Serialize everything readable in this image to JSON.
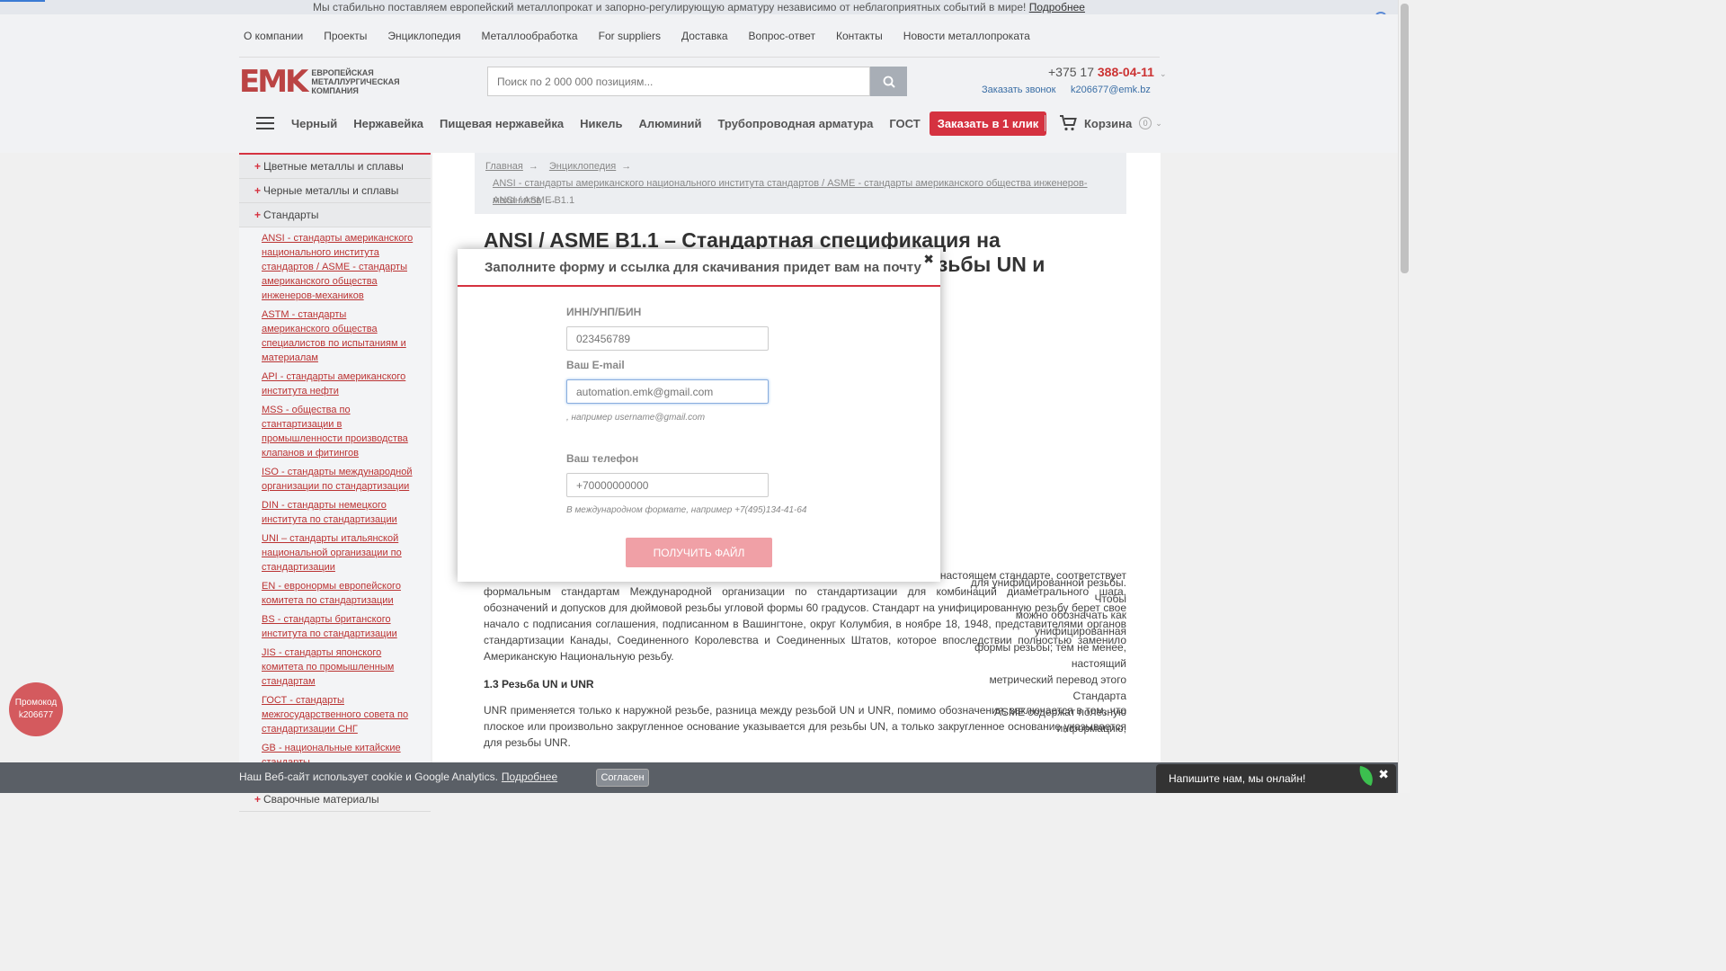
{
  "topbar": {
    "message": "Мы стабильно поставляем европейский металлопрокат и запорно-регулирующую арматуру независимо от неблагоприятных событий в мире!",
    "more_link": "Подробнее"
  },
  "topnav": [
    "О компании",
    "Проекты",
    "Энциклопедия",
    "Металлообработка",
    "For suppliers",
    "Доставка",
    "Вопрос-ответ",
    "Контакты",
    "Новости металлопроката"
  ],
  "logo": {
    "mark": "EMK",
    "line1": "ЕВРОПЕЙСКАЯ",
    "line2": "МЕТАЛЛУРГИЧЕСКАЯ",
    "line3": "КОМПАНИЯ"
  },
  "search": {
    "placeholder": "Поиск по 2 000 000 позициям..."
  },
  "contacts": {
    "phone_prefix": "+375 17 ",
    "phone_main": "388-04-11",
    "callback": "Заказать звонок",
    "email": "k206677@emk.bz"
  },
  "catnav": {
    "items": [
      "Черный",
      "Нержавейка",
      "Пищевая нержавейка",
      "Никель",
      "Алюминий",
      "Трубопроводная арматура",
      "ГОСТ"
    ],
    "oneclick": "Заказать в 1 клик",
    "cart_label": "Корзина",
    "cart_count": "0"
  },
  "sidebar": {
    "cats": [
      "Цветные металлы и сплавы",
      "Черные металлы и сплавы",
      "Стандарты"
    ],
    "subs": [
      "ANSI - стандарты американского национального института стандартов / ASME - стандарты американского общества инженеров-механиков",
      "ASTM - стандарты американского общества специалистов по испытаниям и материалам",
      "API - стандарты американского института нефти",
      "MSS - общества по стантартизации в промышленности производства клапанов и фитингов",
      "ISO - стандарты международной организации по стандартизации",
      "DIN - стандарты немецкого института по стандартизации",
      "UNI – стандарты итальянской национальной организации по стандартизации",
      "EN - евронормы европейского комитета по стандартизации",
      "BS - стандарты британского института по стандартизации",
      "JIS - стандарты японского комитета по промышленным стандартам",
      "ГОСТ - стандарты межгосударственного совета по стандартизации СНГ",
      "GB - национальные китайские стандарты"
    ],
    "last_cat": "Сварочные материалы"
  },
  "breadcrumbs": {
    "home": "Главная",
    "enc": "Энциклопедия",
    "ansi": "ANSI - стандарты американского национального института стандартов / ASME - стандарты американского общества инженеров-механиков",
    "current": "ANSI / ASME B1.1"
  },
  "article": {
    "title_line1": "ANSI / ASME B1.1 – Стандартная спецификация на",
    "title_line2_tail": "резьбы UN и",
    "right_fragments": [
      "для унифицированной резьбы. Чтобы",
      "можно обозначать как унифицированная",
      "формы резьбы; тем не менее, настоящий",
      "метрический перевод этого Стандарта",
      "ASME содержат полезную информацию,"
    ],
    "para2_tail": "настоящем стандарте, соответствует",
    "para2": "формальным стандартам Международной организации по стандартизации для комбинаций диаметрального шага, обозначений и допусков для дюймовой резьбы угловой формы 60 градусов. Стандарт на унифицированную резьбу берет свое начало с подписания соглашения, подписанном в Вашингтоне, округ Колумбия, в ноябре 18, 1948, представителями органов стандартизации Канады, Соединенного Королевства и Соединенных Штатов, которое впоследствии полностью заменило Американскую Национальную резьбу.",
    "h13": "1.3 Резьба UN и UNR",
    "para3": "UNR применяется только к наружной резьбе, разница между резьбой UN и UNR, помимо обозначения, заключается в том, что плоское или произвольно закругленное основание указывается для резьбы UN, а только закругленное основание указывается для резьбы UNR."
  },
  "modal": {
    "heading": "Заполните форму и ссылка для скачивания придет вам на почту",
    "inn_label": "ИНН/УНП/БИН",
    "inn_placeholder": "023456789",
    "email_label": "Ваш E-mail",
    "email_value": "automation.emk@gmail.com",
    "email_hint": ", например username@gmail.com",
    "phone_label": "Ваш телефон",
    "phone_placeholder": "+70000000000",
    "phone_hint": "В международном формате, например +7(495)134-41-64",
    "submit": "ПОЛУЧИТЬ ФАЙЛ"
  },
  "promo": {
    "line1": "Промокод",
    "line2": "k206677"
  },
  "cookie": {
    "text": "Наш Веб-сайт использует cookie и Google Analytics.",
    "more": "Подробнее",
    "agree": "Согласен"
  },
  "chat": {
    "text": "Напишите нам, мы онлайн!"
  },
  "colors": {
    "accent": "#d53240",
    "link": "#3a6ea5"
  }
}
